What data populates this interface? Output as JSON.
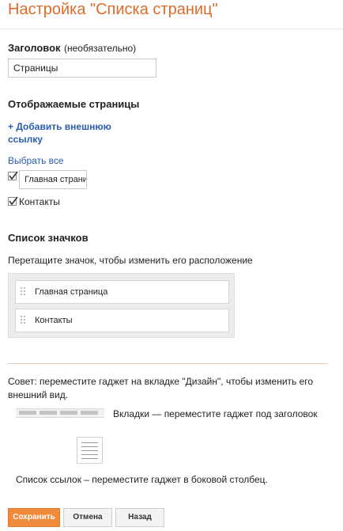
{
  "header": {
    "title": "Настройка \"Списка страниц\""
  },
  "title_field": {
    "label": "Заголовок",
    "optional": "(необязательно)",
    "value": "Страницы"
  },
  "pages": {
    "heading": "Отображаемые страницы",
    "add_link_line1": "+ Добавить внешнюю",
    "add_link_line2": "ссылку",
    "select_all": "Выбрать все",
    "items": [
      {
        "label": "Главная страница",
        "checked": true
      },
      {
        "label": "Контакты",
        "checked": true
      }
    ]
  },
  "icon_list": {
    "heading": "Список значков",
    "hint": "Перетащите значок, чтобы изменить его расположение",
    "items": [
      "Главная страница",
      "Контакты"
    ]
  },
  "tips": {
    "line1": "Совет: переместите гаджет на вкладке \"Дизайн\", чтобы изменить его",
    "line2": "внешний вид.",
    "tabs_hint": "Вкладки — переместите гаджет под заголовок",
    "list_hint": "Список ссылок – переместите гаджет в боковой столбец."
  },
  "buttons": {
    "save": "Сохранить",
    "cancel": "Отмена",
    "back": "Назад"
  },
  "colors": {
    "accent": "#dd6b2b",
    "link": "#2a5db0",
    "save_button": "#f08a3c"
  }
}
